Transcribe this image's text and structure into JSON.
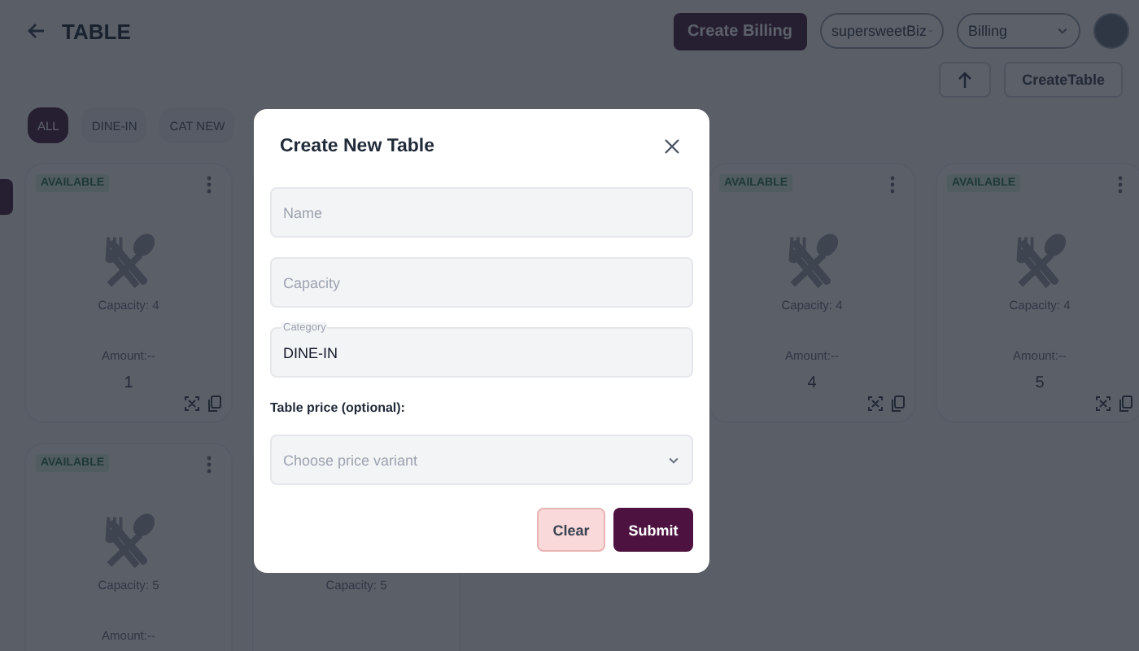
{
  "header": {
    "title": "TABLE",
    "create_billing": "Create Billing",
    "business_select": "supersweetBiz",
    "mode_select": "Billing",
    "create_table": "CreateTable"
  },
  "filters": [
    {
      "label": "ALL",
      "selected": true
    },
    {
      "label": "DINE-IN",
      "selected": false
    },
    {
      "label": "CAT NEW",
      "selected": false
    }
  ],
  "table_rows": [
    [
      {
        "status": "AVAILABLE",
        "capacity": "Capacity: 4",
        "amount": "Amount:--",
        "number": "1"
      },
      null,
      null,
      {
        "status": "AVAILABLE",
        "capacity": "Capacity: 4",
        "amount": "Amount:--",
        "number": "4"
      },
      {
        "status": "AVAILABLE",
        "capacity": "Capacity: 4",
        "amount": "Amount:--",
        "number": "5"
      }
    ],
    [
      {
        "status": "AVAILABLE",
        "capacity": "Capacity: 5",
        "amount": "Amount:--"
      },
      {
        "capacity": "Capacity: 5"
      }
    ]
  ],
  "modal": {
    "title": "Create New Table",
    "fields": [
      {
        "placeholder": "Name"
      },
      {
        "placeholder": "Capacity"
      },
      {
        "label": "Category",
        "value": "DINE-IN"
      }
    ],
    "price_label": "Table price (optional):",
    "price_placeholder": "Choose price variant",
    "clear": "Clear",
    "submit": "Submit"
  }
}
